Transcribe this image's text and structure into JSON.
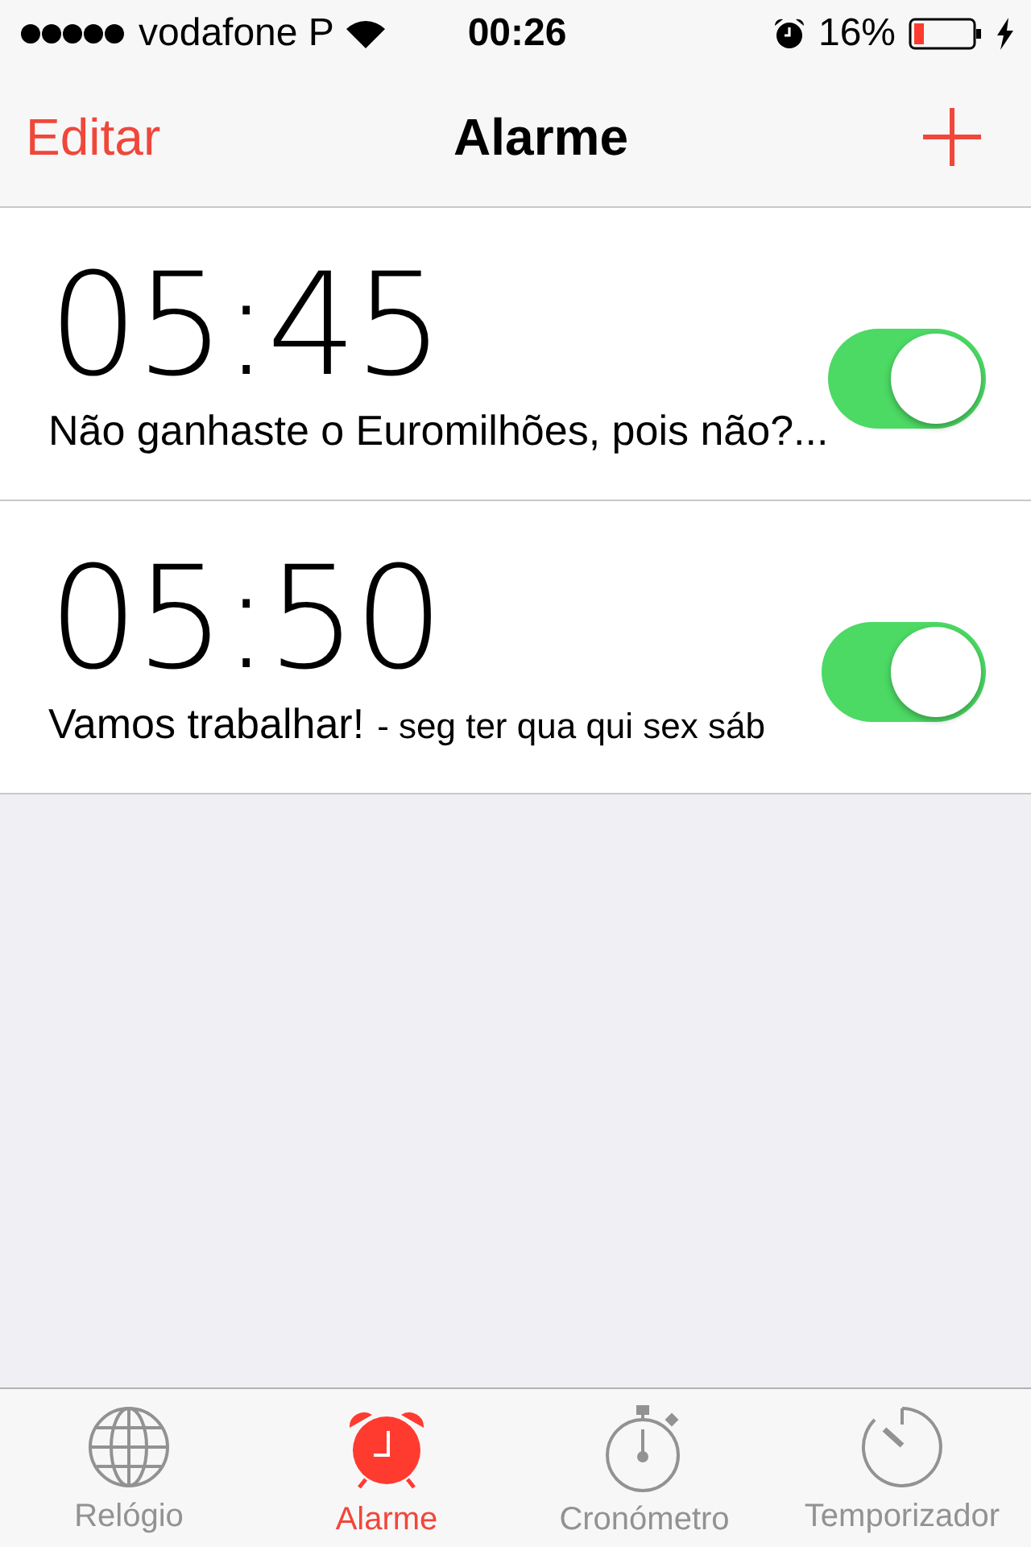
{
  "status_bar": {
    "carrier": "vodafone P",
    "time": "00:26",
    "battery": "16%"
  },
  "nav": {
    "edit": "Editar",
    "title": "Alarme"
  },
  "alarms": [
    {
      "time": "05:45",
      "label": "Não ganhaste o Euromilhões, pois não?...",
      "on": true
    },
    {
      "time": "05:50",
      "label": "Vamos trabalhar!",
      "repeat": "- seg ter qua qui sex sáb",
      "on": true
    }
  ],
  "tabs": [
    {
      "kind": "globe",
      "label": "Relógio",
      "selected": false
    },
    {
      "kind": "alarm",
      "label": "Alarme",
      "selected": true
    },
    {
      "kind": "stopwatch",
      "label": "Cronómetro",
      "selected": false
    },
    {
      "kind": "timer",
      "label": "Temporizador",
      "selected": false
    }
  ]
}
